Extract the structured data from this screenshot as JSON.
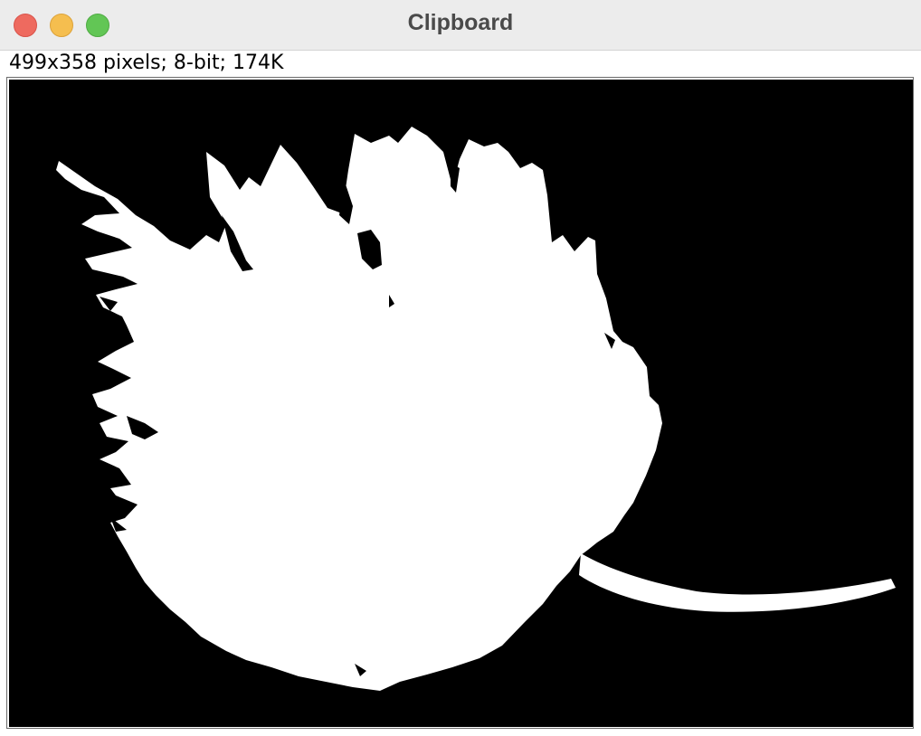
{
  "window": {
    "title": "Clipboard"
  },
  "image_info": {
    "text": "499x358 pixels; 8-bit; 174K"
  },
  "image": {
    "description_icon": "binary-leaf-mask-image",
    "foreground_color": "#ffffff",
    "background_color": "#000000"
  },
  "colors": {
    "close": "#ee6a5f",
    "minimize": "#f5be4f",
    "zoom": "#62c655"
  }
}
